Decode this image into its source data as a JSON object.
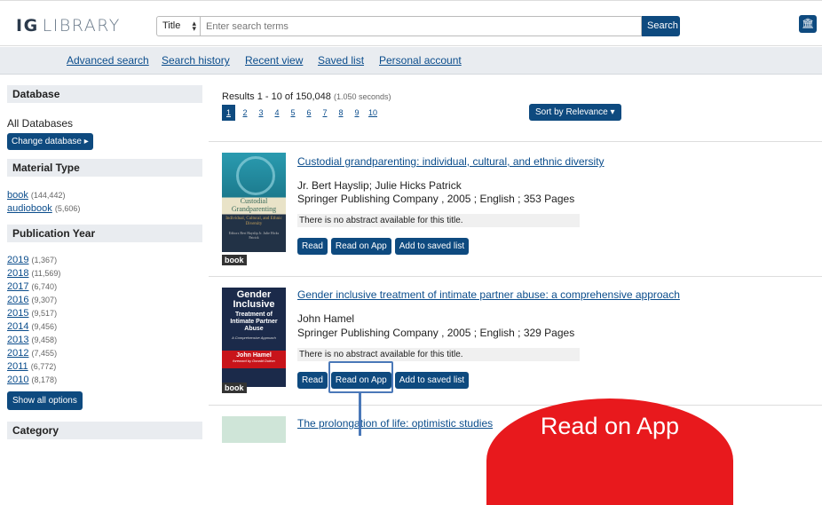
{
  "header": {
    "logo_bold": "IG",
    "logo_light": "LIBRARY",
    "search_field": "Title",
    "search_placeholder": "Enter search terms",
    "search_button": "Search",
    "library_icon": "bank-icon"
  },
  "nav": [
    "Advanced search",
    "Search history",
    "Recent view",
    "Saved list",
    "Personal account"
  ],
  "sidebar": {
    "database_head": "Database",
    "database_value": "All Databases",
    "change_database": "Change database ▸",
    "material_head": "Material Type",
    "materials": [
      {
        "label": "book",
        "count": "(144,442)"
      },
      {
        "label": "audiobook",
        "count": "(5,606)"
      }
    ],
    "year_head": "Publication Year",
    "years": [
      {
        "label": "2019",
        "count": "(1,367)"
      },
      {
        "label": "2018",
        "count": "(11,569)"
      },
      {
        "label": "2017",
        "count": "(6,740)"
      },
      {
        "label": "2016",
        "count": "(9,307)"
      },
      {
        "label": "2015",
        "count": "(9,517)"
      },
      {
        "label": "2014",
        "count": "(9,456)"
      },
      {
        "label": "2013",
        "count": "(9,458)"
      },
      {
        "label": "2012",
        "count": "(7,455)"
      },
      {
        "label": "2011",
        "count": "(6,772)"
      },
      {
        "label": "2010",
        "count": "(8,178)"
      }
    ],
    "show_all": "Show all options",
    "category_head": "Category"
  },
  "results": {
    "summary": "Results 1 - 10 of 150,048",
    "seconds": "(1.050 seconds)",
    "pages": [
      "1",
      "2",
      "3",
      "4",
      "5",
      "6",
      "7",
      "8",
      "9",
      "10"
    ],
    "sort": "Sort by Relevance ▾",
    "items": [
      {
        "title": "Custodial grandparenting: individual, cultural, and ethnic diversity",
        "authors": "Jr. Bert Hayslip; Julie Hicks Patrick",
        "publisher": "Springer Publishing Company , 2005 ; English ; 353 Pages",
        "abstract": "There is no abstract available for this title.",
        "type": "book",
        "cover_title": "Custodial Grandparenting",
        "cover_sub": "Individual, Cultural, and Ethnic Diversity",
        "cover_eds": "Editors Bert Hayslip Jr. Julie Hicks Patrick"
      },
      {
        "title": "Gender inclusive treatment of intimate partner abuse: a comprehensive approach",
        "authors": "John Hamel",
        "publisher": "Springer Publishing Company , 2005 ; English ; 329 Pages",
        "abstract": "There is no abstract available for this title.",
        "type": "book",
        "cover_title": "Gender Inclusive",
        "cover_sub": "Treatment of Intimate Partner Abuse",
        "cover_small": "A Comprehensive Approach",
        "cover_author": "John Hamel",
        "cover_foreword": "foreword by Donald Dutton"
      },
      {
        "title": "The prolongation of life: optimistic studies"
      }
    ],
    "buttons": {
      "read": "Read",
      "read_app": "Read on App",
      "save": "Add to saved list"
    }
  },
  "callout": "Read on App",
  "colors": {
    "primary": "#0e4a7f",
    "callout": "#e8191d",
    "highlight": "#4a78b8"
  }
}
